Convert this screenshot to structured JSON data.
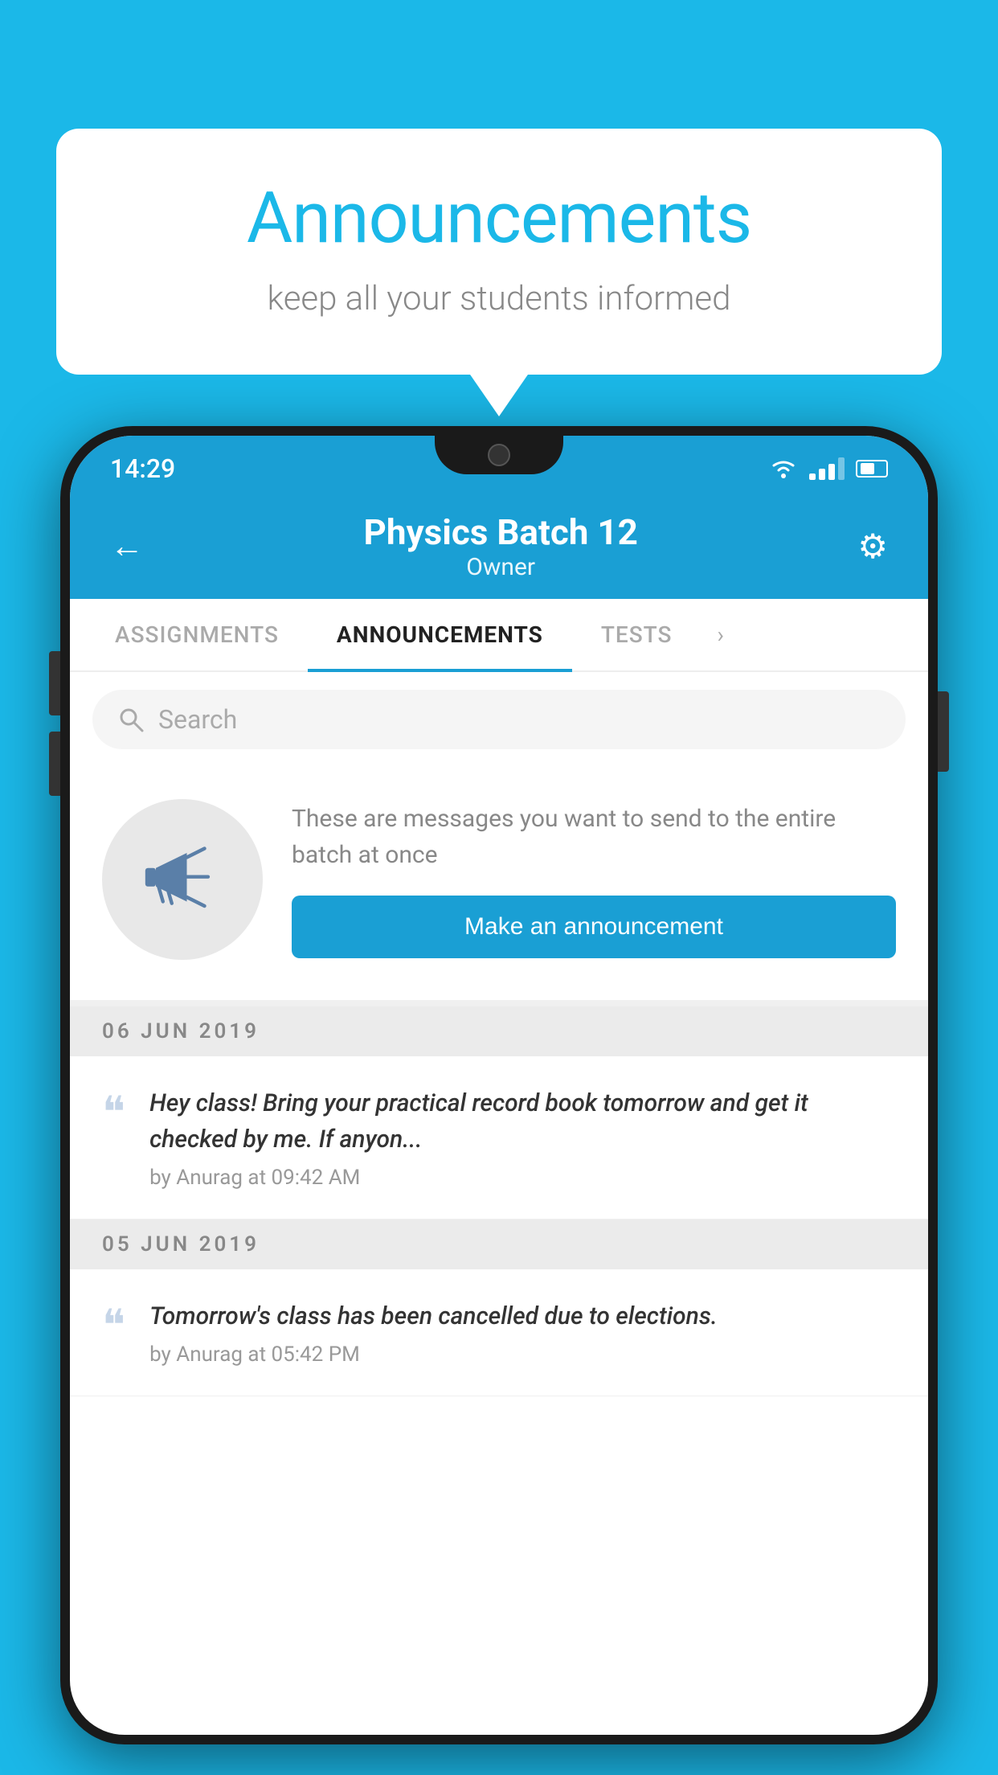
{
  "bubble": {
    "title": "Announcements",
    "subtitle": "keep all your students informed"
  },
  "statusBar": {
    "time": "14:29"
  },
  "header": {
    "title": "Physics Batch 12",
    "subtitle": "Owner",
    "backLabel": "←",
    "gearLabel": "⚙"
  },
  "tabs": [
    {
      "label": "ASSIGNMENTS",
      "active": false
    },
    {
      "label": "ANNOUNCEMENTS",
      "active": true
    },
    {
      "label": "TESTS",
      "active": false
    }
  ],
  "search": {
    "placeholder": "Search"
  },
  "promo": {
    "description": "These are messages you want to send to the entire batch at once",
    "buttonLabel": "Make an announcement"
  },
  "announcements": [
    {
      "date": "06  JUN  2019",
      "text": "Hey class! Bring your practical record book tomorrow and get it checked by me. If anyon...",
      "meta": "by Anurag at 09:42 AM"
    },
    {
      "date": "05  JUN  2019",
      "text": "Tomorrow's class has been cancelled due to elections.",
      "meta": "by Anurag at 05:42 PM"
    }
  ],
  "colors": {
    "brand": "#1a9fd4",
    "background": "#1BB8E8"
  }
}
